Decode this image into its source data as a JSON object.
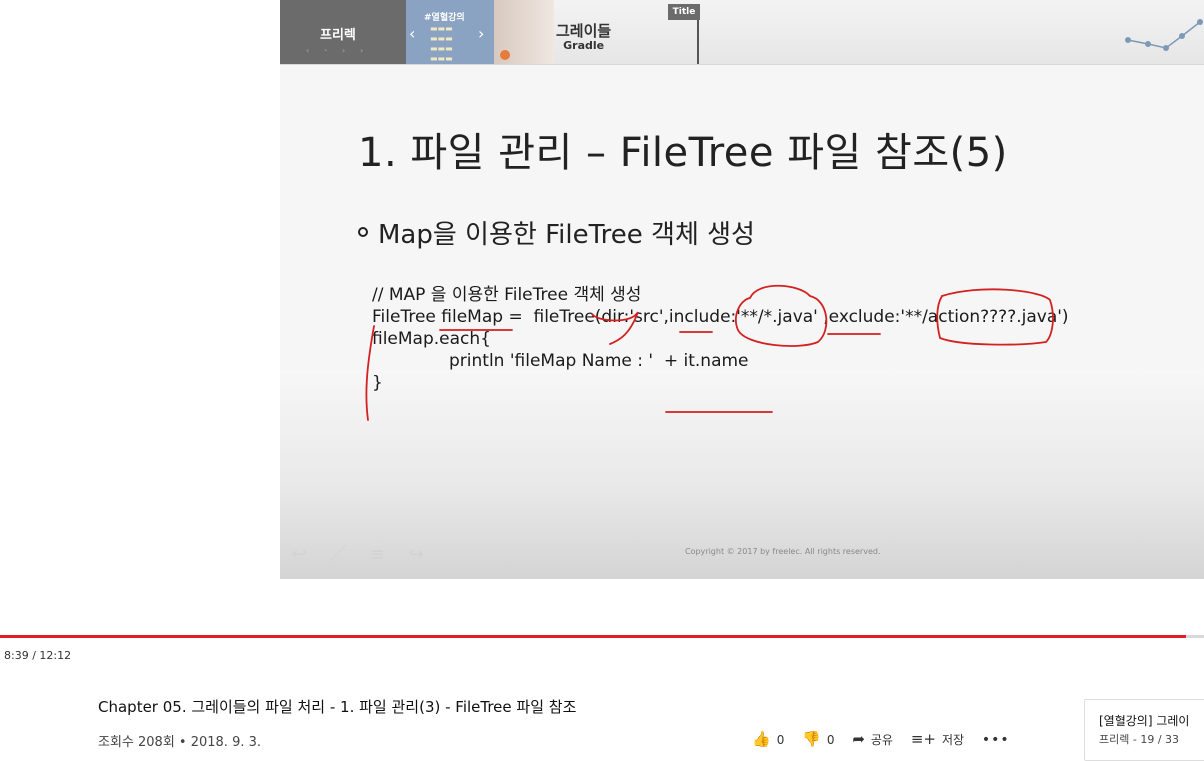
{
  "slide": {
    "brand": "프리렉",
    "promo_tag": "#열혈강의",
    "course_title_ko": "그레이들",
    "course_title_en": "Gradle",
    "title_tab": "Title",
    "heading": "1. 파일 관리 – FileTree 파일 참조(5)",
    "bullet": "Map을 이용한 FileTree 객체 생성",
    "code": [
      "// MAP 을 이용한 FileTree 객체 생성",
      "FileTree fileMap =  fileTree(dir:'src',include:'**/*.java' ,exclude:'**/action????.java')",
      "",
      "fileMap.each{",
      "println 'fileMap Name : '  + it.name",
      "}"
    ],
    "copyright": "Copyright © 2017 by freelec. All rights reserved."
  },
  "player": {
    "time": "8:39 / 12:12",
    "progress": 0.985
  },
  "video": {
    "title": "Chapter 05. 그레이들의 파일 처리 - 1. 파일 관리(3) - FileTree 파일 참조",
    "views": "조회수 208회 • 2018. 9. 3.",
    "likes": "0",
    "dislikes": "0",
    "share": "공유",
    "save": "저장"
  },
  "playlist": {
    "title": "[열혈강의] 그레이",
    "sub": "프리렉 - 19 / 33"
  },
  "colors": {
    "accent": "#e02020",
    "annotation": "#d42020"
  }
}
